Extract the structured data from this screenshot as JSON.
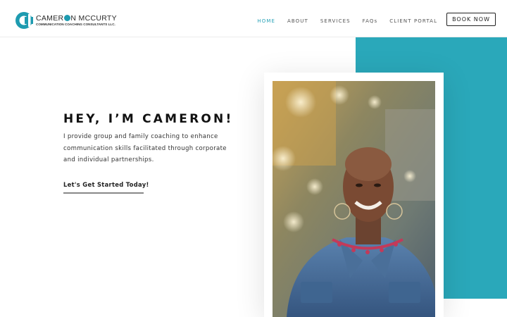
{
  "brand": {
    "name_part1": "CAMER",
    "name_part2": "N MCCURTY",
    "tagline": "COMMUNICATION COACHING CONSULTANTS LLC.",
    "accent_color": "#1e9bb0",
    "logo_icon": "c-monogram-icon"
  },
  "nav": {
    "items": [
      {
        "label": "HOME",
        "active": true
      },
      {
        "label": "ABOUT",
        "active": false
      },
      {
        "label": "SERVICES",
        "active": false
      },
      {
        "label": "FAQs",
        "active": false
      },
      {
        "label": "CLIENT PORTAL",
        "active": false
      }
    ],
    "book_label": "BOOK NOW"
  },
  "hero": {
    "title": "HEY, I’M CAMERON!",
    "description": "I provide group and family coaching to enhance communication skills facilitated through corporate and individual partnerships.",
    "cta_label": "Let's Get Started Today!",
    "accent_color": "#2aa8ba",
    "photo_icon": "portrait-photo"
  }
}
